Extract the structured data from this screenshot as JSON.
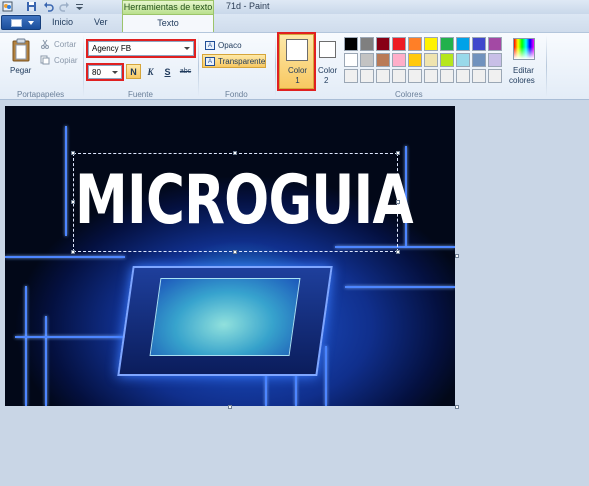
{
  "titlebar": {
    "contextual_tab": "Herramientas de texto",
    "window_title": "71d - Paint"
  },
  "tabs": {
    "inicio": "Inicio",
    "ver": "Ver",
    "texto": "Texto"
  },
  "portapapeles": {
    "pegar": "Pegar",
    "cortar": "Cortar",
    "copiar": "Copiar",
    "group": "Portapapeles"
  },
  "fuente": {
    "font_name": "Agency FB",
    "font_size": "80",
    "bold": "N",
    "italic": "K",
    "underline": "S",
    "strike": "abc",
    "group": "Fuente"
  },
  "fondo": {
    "opaco": "Opaco",
    "transparente": "Transparente",
    "group": "Fondo"
  },
  "colores": {
    "color1_line1": "Color",
    "color1_line2": "1",
    "color2_line1": "Color",
    "color2_line2": "2",
    "edit_line1": "Editar",
    "edit_line2": "colores",
    "group": "Colores",
    "color1_value": "#ffffff",
    "color2_value": "#ffffff",
    "palette_row1": [
      "#000000",
      "#7f7f7f",
      "#880015",
      "#ed1c24",
      "#ff7f27",
      "#fff200",
      "#22b14c",
      "#00a2e8",
      "#3f48cc",
      "#a349a4"
    ],
    "palette_row2": [
      "#ffffff",
      "#c3c3c3",
      "#b97a57",
      "#ffaec9",
      "#ffc90e",
      "#efe4b0",
      "#b5e61d",
      "#99d9ea",
      "#7092be",
      "#c8bfe7"
    ],
    "palette_row3": [
      "#f0f0f0",
      "#f0f0f0",
      "#f0f0f0",
      "#f0f0f0",
      "#f0f0f0",
      "#f0f0f0",
      "#f0f0f0",
      "#f0f0f0",
      "#f0f0f0",
      "#f0f0f0"
    ]
  },
  "canvas": {
    "text": "MICROGUIA"
  }
}
